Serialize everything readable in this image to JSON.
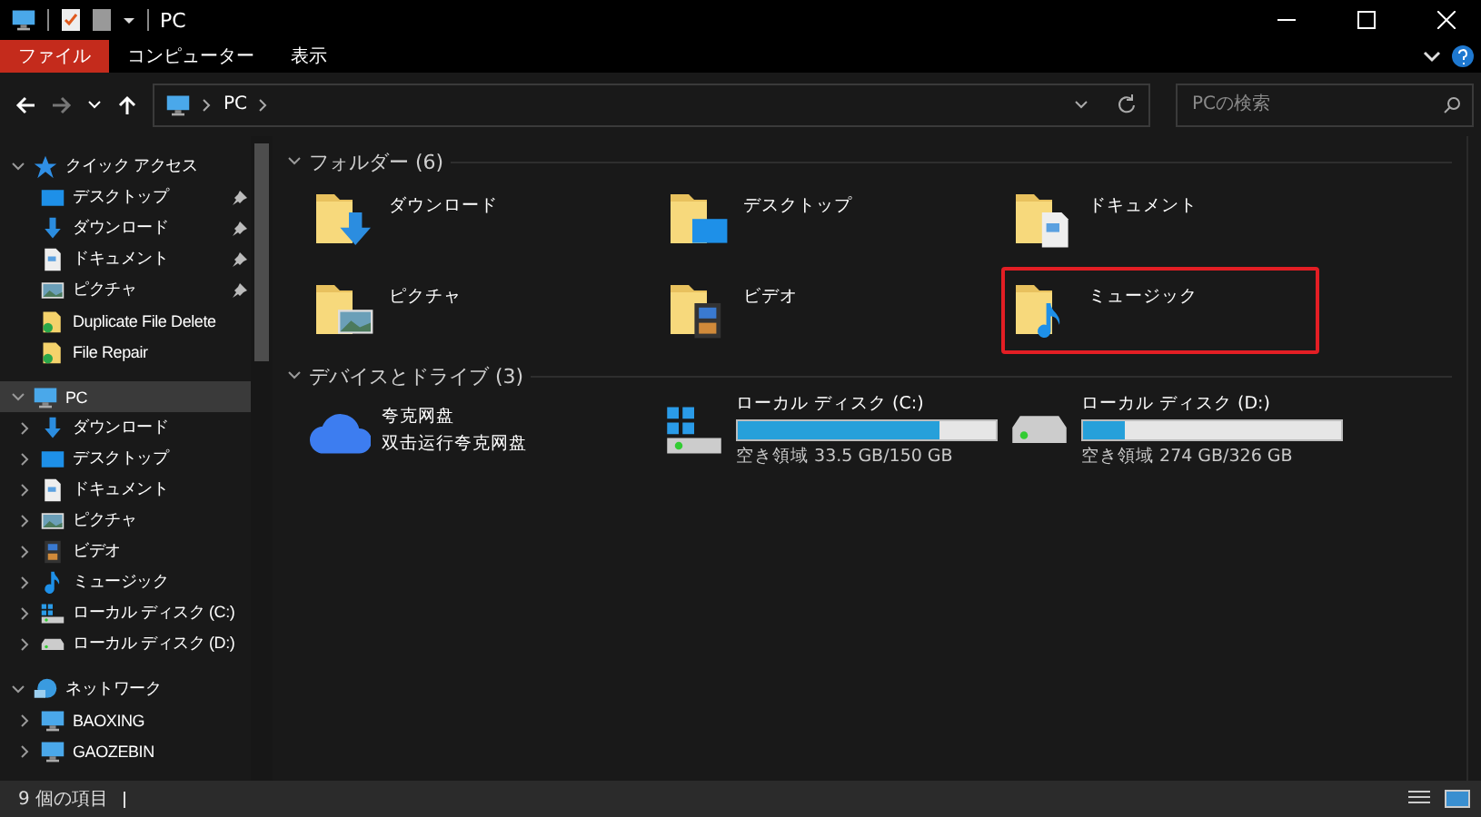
{
  "title_bar": {
    "title": "PC"
  },
  "ribbon": {
    "tabs": [
      {
        "label": "ファイル",
        "kind": "file"
      },
      {
        "label": "コンピューター",
        "kind": "tab"
      },
      {
        "label": "表示",
        "kind": "tab"
      }
    ]
  },
  "address_bar": {
    "path": [
      "PC"
    ],
    "search": {
      "placeholder": "PCの検索"
    }
  },
  "sidebar": {
    "sections": [
      {
        "label": "クイック アクセス",
        "kind": "quickaccess",
        "expanded": true,
        "selected": false,
        "children": [
          {
            "label": "デスクトップ",
            "kind": "desktop",
            "pinned": true
          },
          {
            "label": "ダウンロード",
            "kind": "download",
            "pinned": true
          },
          {
            "label": "ドキュメント",
            "kind": "document",
            "pinned": true
          },
          {
            "label": "ピクチャ",
            "kind": "picture",
            "pinned": true
          },
          {
            "label": "Duplicate File Delete",
            "kind": "shortcut",
            "pinned": false
          },
          {
            "label": "File Repair",
            "kind": "shortcut",
            "pinned": false
          }
        ]
      },
      {
        "label": "PC",
        "kind": "pc",
        "expanded": true,
        "selected": true,
        "children": [
          {
            "label": "ダウンロード",
            "kind": "download",
            "pinned": false
          },
          {
            "label": "デスクトップ",
            "kind": "desktop",
            "pinned": false
          },
          {
            "label": "ドキュメント",
            "kind": "document",
            "pinned": false
          },
          {
            "label": "ピクチャ",
            "kind": "picture",
            "pinned": false
          },
          {
            "label": "ビデオ",
            "kind": "video",
            "pinned": false
          },
          {
            "label": "ミュージック",
            "kind": "music",
            "pinned": false
          },
          {
            "label": "ローカル ディスク (C:)",
            "kind": "systemdrive",
            "pinned": false
          },
          {
            "label": "ローカル ディスク (D:)",
            "kind": "drive",
            "pinned": false
          }
        ]
      },
      {
        "label": "ネットワーク",
        "kind": "network",
        "expanded": true,
        "selected": false,
        "children": [
          {
            "label": "BAOXING",
            "kind": "pc",
            "pinned": false
          },
          {
            "label": "GAOZEBIN",
            "kind": "pc",
            "pinned": false
          }
        ]
      }
    ]
  },
  "folders": {
    "header": "フォルダー (6)",
    "items": [
      {
        "label": "ダウンロード",
        "kind": "download",
        "highlighted": false
      },
      {
        "label": "デスクトップ",
        "kind": "desktop",
        "highlighted": false
      },
      {
        "label": "ドキュメント",
        "kind": "document",
        "highlighted": false
      },
      {
        "label": "ピクチャ",
        "kind": "picture",
        "highlighted": false
      },
      {
        "label": "ビデオ",
        "kind": "video",
        "highlighted": false
      },
      {
        "label": "ミュージック",
        "kind": "music",
        "highlighted": true
      }
    ]
  },
  "devices": {
    "header": "デバイスとドライブ (3)",
    "items": [
      {
        "kind": "app",
        "label": "夸克网盘",
        "subtitle": "双击运行夸克网盘"
      },
      {
        "kind": "systemdrive",
        "label": "ローカル ディスク (C:)",
        "level": 0.78,
        "free": "空き領域 33.5 GB/150 GB"
      },
      {
        "kind": "drive",
        "label": "ローカル ディスク (D:)",
        "level": 0.16,
        "free": "空き領域 274 GB/326 GB"
      }
    ]
  },
  "status_bar": {
    "count": "9 個の項目"
  }
}
